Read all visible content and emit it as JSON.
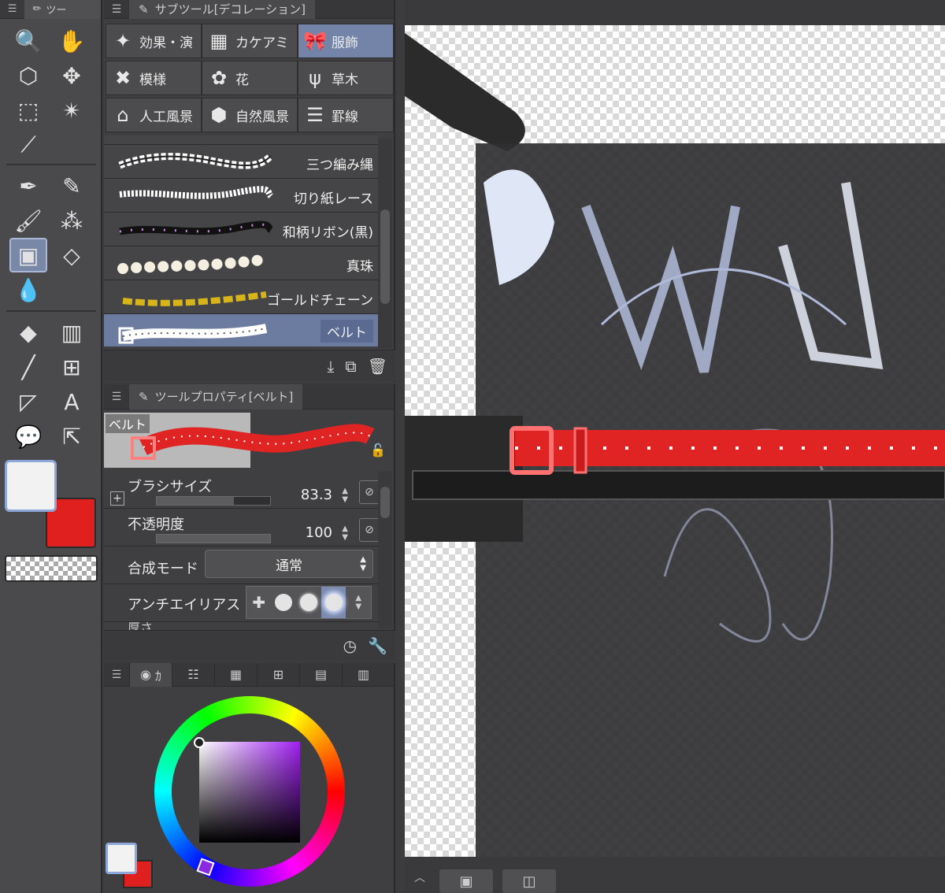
{
  "toolbar": {
    "menu_glyph": "☰",
    "tab_label": "ツー",
    "tools": [
      {
        "name": "zoom-icon",
        "glyph": "🔍"
      },
      {
        "name": "hand-icon",
        "glyph": "✋"
      },
      {
        "name": "object-select-icon",
        "glyph": "⬡"
      },
      {
        "name": "move-icon",
        "glyph": "✥"
      },
      {
        "name": "rect-select-icon",
        "glyph": "⬚"
      },
      {
        "name": "magic-wand-icon",
        "glyph": "✴"
      },
      {
        "name": "eyedropper-icon",
        "glyph": "⟋"
      },
      {
        "name": "pen-icon",
        "glyph": "✒"
      },
      {
        "name": "pencil-icon",
        "glyph": "✎"
      },
      {
        "name": "brush-icon",
        "glyph": "🖌"
      },
      {
        "name": "airbrush-icon",
        "glyph": "⁂"
      },
      {
        "name": "decoration-icon",
        "glyph": "▣"
      },
      {
        "name": "eraser-icon",
        "glyph": "◇"
      },
      {
        "name": "blend-icon",
        "glyph": "💧"
      },
      {
        "name": "fill-icon",
        "glyph": "◆"
      },
      {
        "name": "gradient-icon",
        "glyph": "▥"
      },
      {
        "name": "line-icon",
        "glyph": "╱"
      },
      {
        "name": "frame-icon",
        "glyph": "⊞"
      },
      {
        "name": "ruler-icon",
        "glyph": "◸"
      },
      {
        "name": "text-icon",
        "glyph": "A"
      },
      {
        "name": "balloon-icon",
        "glyph": "💬"
      },
      {
        "name": "correct-line-icon",
        "glyph": "⇱"
      }
    ]
  },
  "subtool": {
    "menu_glyph": "☰",
    "title": "サブツール[デコレーション]",
    "categories": [
      {
        "label": "効果・演",
        "icon": "✦"
      },
      {
        "label": "カケアミ",
        "icon": "▦"
      },
      {
        "label": "服飾",
        "icon": "🎀"
      },
      {
        "label": "模様",
        "icon": "✖"
      },
      {
        "label": "花",
        "icon": "✿"
      },
      {
        "label": "草木",
        "icon": "ψ"
      },
      {
        "label": "人工風景",
        "icon": "⌂"
      },
      {
        "label": "自然風景",
        "icon": "⬢"
      },
      {
        "label": "罫線",
        "icon": "☰"
      }
    ],
    "brushes": [
      {
        "label": "三つ編み縄"
      },
      {
        "label": "切り紙レース"
      },
      {
        "label": "和柄リボン(黒)"
      },
      {
        "label": "真珠"
      },
      {
        "label": "ゴールドチェーン"
      },
      {
        "label": "ベルト"
      }
    ],
    "footer_icons": [
      "⤓",
      "⧉",
      "🗑"
    ]
  },
  "toolprop": {
    "menu_glyph": "☰",
    "title": "ツールプロパティ[ベルト]",
    "preview_label": "ベルト",
    "brush_size": {
      "label": "ブラシサイズ",
      "value": "83.3",
      "fill": 0.68
    },
    "opacity": {
      "label": "不透明度",
      "value": "100",
      "fill": 1.0
    },
    "blend_mode": {
      "label": "合成モード",
      "value": "通常"
    },
    "antialias": {
      "label": "アンチエイリアス"
    },
    "thickness": {
      "label": "厚さ"
    },
    "footer_icons": [
      "◷",
      "🔧"
    ]
  },
  "colorpanel": {
    "menu_glyph": "☰",
    "first_tab": "ｶ"
  },
  "colors": {
    "main": "#f2f2f2",
    "sub": "#e0201f",
    "accent": "#7384a8",
    "belt_red": "#e02424"
  }
}
